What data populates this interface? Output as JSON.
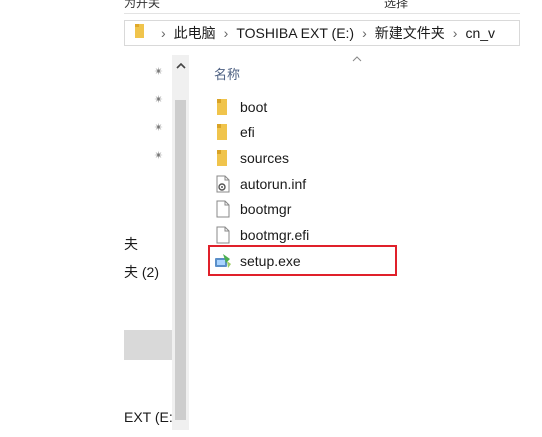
{
  "ribbon": {
    "fragment_left": "为开关",
    "fragment_right": "选择"
  },
  "address_bar": {
    "crumbs": [
      "此电脑",
      "TOSHIBA EXT (E:)",
      "新建文件夹",
      "cn_v"
    ]
  },
  "nav_pane": {
    "items": [
      "夫",
      "夫 (2)",
      "EXT (E:"
    ]
  },
  "file_list": {
    "column_header": "名称",
    "files": [
      {
        "name": "boot",
        "icon": "folder-icon"
      },
      {
        "name": "efi",
        "icon": "folder-icon"
      },
      {
        "name": "sources",
        "icon": "folder-icon"
      },
      {
        "name": "autorun.inf",
        "icon": "settings-file-icon"
      },
      {
        "name": "bootmgr",
        "icon": "file-icon"
      },
      {
        "name": "bootmgr.efi",
        "icon": "file-icon"
      },
      {
        "name": "setup.exe",
        "icon": "setup-app-icon"
      }
    ]
  },
  "colors": {
    "folder": "#f0c44c",
    "highlight": "#e0202a",
    "header_text": "#4d6082"
  }
}
